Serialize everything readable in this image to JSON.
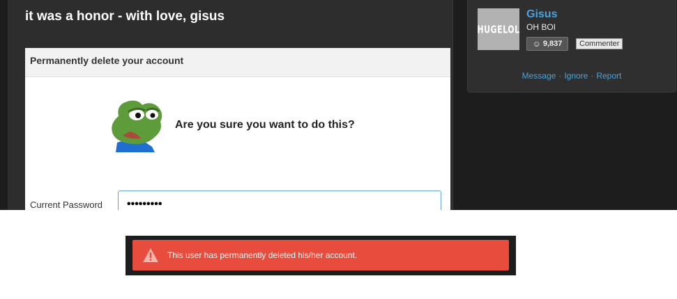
{
  "post": {
    "title": "it was a honor - with love, gisus"
  },
  "dialog": {
    "title": "Permanently delete your account",
    "question": "Are you sure you want to do this?",
    "password_label": "Current Password",
    "password_value": "•••••••••"
  },
  "profile": {
    "avatar_text": "HUGELOL",
    "username": "Gisus",
    "user_title": "OH BOI",
    "karma": "9,837",
    "role": "Commenter",
    "links": {
      "message": "Message",
      "ignore": "Ignore",
      "report": "Report"
    },
    "separator": "·"
  },
  "alert": {
    "message": "This user has permanently deleted his/her account.",
    "color": "#e74c3c"
  },
  "colors": {
    "link": "#4aa3df",
    "panel": "#2d2d2d",
    "background": "#1d1d1d"
  },
  "icons": {
    "frog": "pepe-frog-image",
    "karma": "smiley-icon",
    "alert": "warning-triangle-icon"
  }
}
